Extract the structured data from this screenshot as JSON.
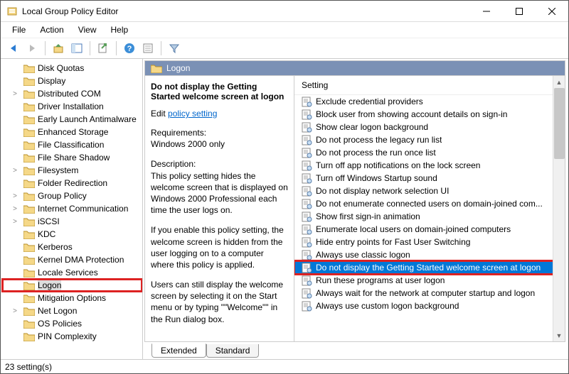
{
  "window": {
    "title": "Local Group Policy Editor"
  },
  "menu": {
    "file": "File",
    "action": "Action",
    "view": "View",
    "help": "Help"
  },
  "tree": {
    "items": [
      {
        "label": "Disk Quotas",
        "expander": ""
      },
      {
        "label": "Display",
        "expander": ""
      },
      {
        "label": "Distributed COM",
        "expander": ">"
      },
      {
        "label": "Driver Installation",
        "expander": ""
      },
      {
        "label": "Early Launch Antimalware",
        "expander": ""
      },
      {
        "label": "Enhanced Storage",
        "expander": ""
      },
      {
        "label": "File Classification",
        "expander": ""
      },
      {
        "label": "File Share Shadow",
        "expander": ""
      },
      {
        "label": "Filesystem",
        "expander": ">"
      },
      {
        "label": "Folder Redirection",
        "expander": ""
      },
      {
        "label": "Group Policy",
        "expander": ">"
      },
      {
        "label": "Internet Communication",
        "expander": ">"
      },
      {
        "label": "iSCSI",
        "expander": ">"
      },
      {
        "label": "KDC",
        "expander": ""
      },
      {
        "label": "Kerberos",
        "expander": ""
      },
      {
        "label": "Kernel DMA Protection",
        "expander": ""
      },
      {
        "label": "Locale Services",
        "expander": ""
      },
      {
        "label": "Logon",
        "expander": "",
        "selected": true
      },
      {
        "label": "Mitigation Options",
        "expander": ""
      },
      {
        "label": "Net Logon",
        "expander": ">"
      },
      {
        "label": "OS Policies",
        "expander": ""
      },
      {
        "label": "PIN Complexity",
        "expander": ""
      }
    ]
  },
  "header": {
    "title": "Logon"
  },
  "description": {
    "policy_title": "Do not display the Getting Started welcome screen at logon",
    "edit_prefix": "Edit ",
    "edit_link": "policy setting",
    "requirements_label": "Requirements:",
    "requirements_value": "Windows 2000 only",
    "description_label": "Description:",
    "description_p1": "This policy setting hides the welcome screen that is displayed on Windows 2000 Professional each time the user logs on.",
    "description_p2": "If you enable this policy setting, the welcome screen is hidden from the user logging on to a computer where this policy is applied.",
    "description_p3": "Users can still display the welcome screen by selecting it on the Start menu or by typing \"\"Welcome\"\" in the Run dialog box."
  },
  "list": {
    "column": "Setting",
    "items": [
      "Exclude credential providers",
      "Block user from showing account details on sign-in",
      "Show clear logon background",
      "Do not process the legacy run list",
      "Do not process the run once list",
      "Turn off app notifications on the lock screen",
      "Turn off Windows Startup sound",
      "Do not display network selection UI",
      "Do not enumerate connected users on domain-joined com...",
      "Show first sign-in animation",
      "Enumerate local users on domain-joined computers",
      "Hide entry points for Fast User Switching",
      "Always use classic logon",
      "Do not display the Getting Started welcome screen at logon",
      "Run these programs at user logon",
      "Always wait for the network at computer startup and logon",
      "Always use custom logon background"
    ],
    "selected_index": 13
  },
  "tabs": {
    "extended": "Extended",
    "standard": "Standard"
  },
  "status": {
    "text": "23 setting(s)"
  }
}
